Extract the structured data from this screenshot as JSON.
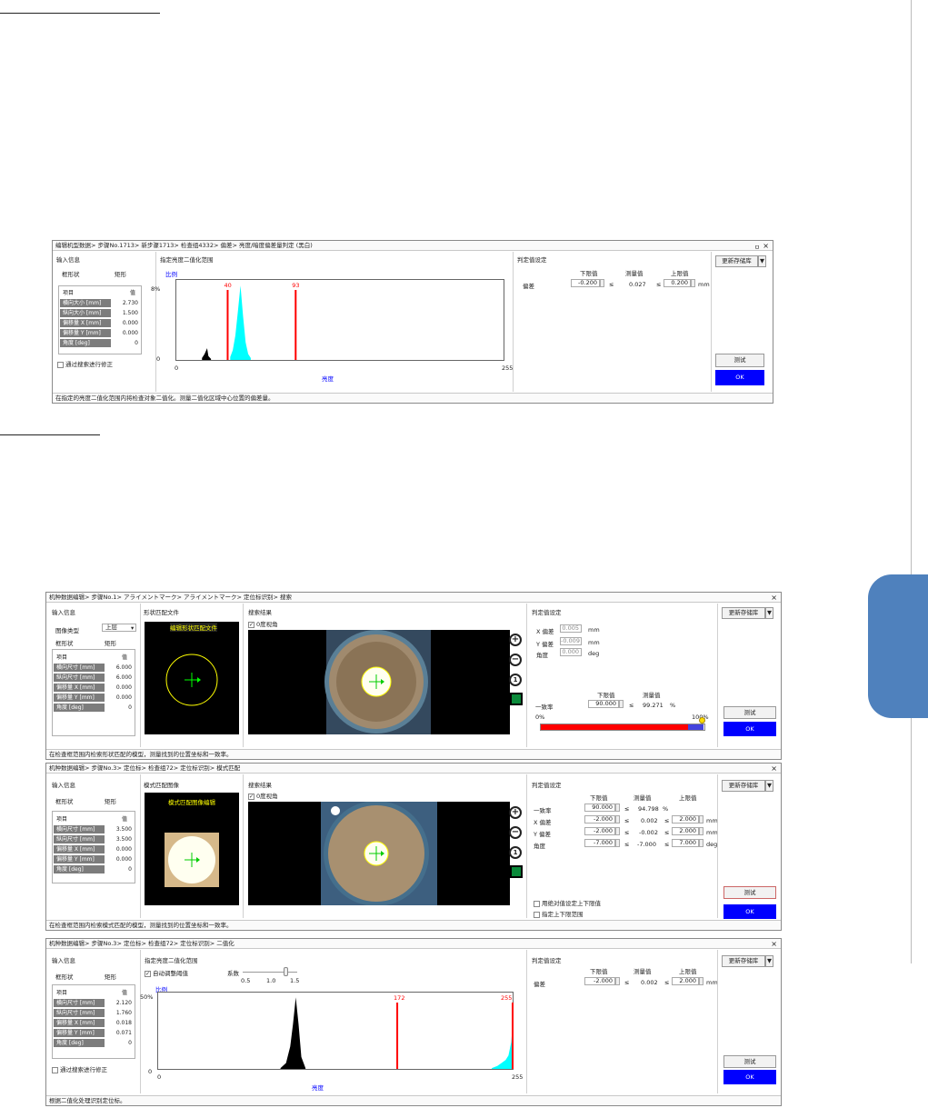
{
  "page": {
    "side_tab_color": "#4f81bd"
  },
  "panel1": {
    "title": "编辑机型数据> 步骤No.1713> 新步骤1713> 检查组4332> 偏差> 亮度/暗度偏差量判定 (黑白)",
    "close": "×",
    "pin": "ㅁ",
    "input_info": "输入信息",
    "shape_label": "框形状",
    "shape_value": "矩形",
    "table_head": {
      "item": "项目",
      "value": "值"
    },
    "params": [
      {
        "k": "横向大小 [mm]",
        "v": "2.730"
      },
      {
        "k": "纵向大小 [mm]",
        "v": "1.500"
      },
      {
        "k": "偏移量 X [mm]",
        "v": "0.000"
      },
      {
        "k": "偏移量 Y [mm]",
        "v": "0.000"
      },
      {
        "k": "角度 [deg]",
        "v": "0"
      }
    ],
    "correct_checkbox": "通过搜索进行修正",
    "histogram_title": "指定亮度二值化范围",
    "ratio": "比例",
    "y_max": "8%",
    "y_min": "0",
    "x_min": "0",
    "x_max": "255",
    "x_label": "亮度",
    "judge_title": "判定值设定",
    "lower_head": "下限值",
    "measured_head": "测量值",
    "upper_head": "上限值",
    "row_label": "偏差",
    "lower": "-0.200",
    "measured": "0.027",
    "upper": "0.200",
    "le1": "≤",
    "le2": "≤",
    "unit": "mm",
    "update_button": "更新存储库",
    "test_button": "测试",
    "ok_button": "OK",
    "status": "在指定的亮度二值化范围内将检查对象二值化。测量二值化区域中心位置的偏差量。"
  },
  "panel2": {
    "title": "机种数据编辑> 步骤No.1> アライメントマーク> アライメントマーク> 定位标识别> 搜索",
    "close": "×",
    "input_info": "输入信息",
    "image_type_label": "图像类型",
    "image_type_value": "上层",
    "shape_label": "框形状",
    "shape_value": "矩形",
    "table_head": {
      "item": "项目",
      "value": "值"
    },
    "params": [
      {
        "k": "横向尺寸 [mm]",
        "v": "6.000"
      },
      {
        "k": "纵向尺寸 [mm]",
        "v": "6.000"
      },
      {
        "k": "偏移量 X [mm]",
        "v": "0.000"
      },
      {
        "k": "偏移量 Y [mm]",
        "v": "0.000"
      },
      {
        "k": "角度 [deg]",
        "v": "0"
      }
    ],
    "match_file_title": "形状匹配文件",
    "match_file_button": "编辑形状匹配文件",
    "search_result_title": "搜索结果",
    "zero_view": "0度视角",
    "judge_title": "判定值设定",
    "x_dev_label": "X 偏差",
    "x_dev": "0.005",
    "y_dev_label": "Y 偏差",
    "y_dev": "-0.009",
    "angle_label": "角度",
    "angle": "0.000",
    "unit_mm1": "mm",
    "unit_mm2": "mm",
    "unit_deg": "deg",
    "lower_head": "下限值",
    "measured_head": "测量值",
    "match_label": "一致率",
    "match_lower": "90.000",
    "match_measured": "99.271",
    "le": "≤",
    "pct": "%",
    "bar_min": "0%",
    "bar_max": "100%",
    "update_button": "更新存储库",
    "test_button": "测试",
    "ok_button": "OK",
    "status": "在检查框范围内检索形状匹配的模型，测量找到的位置坐标和一致率。"
  },
  "panel3": {
    "title": "机种数据编辑> 步骤No.3> 定位标> 检查组72> 定位标识别> 模式匹配",
    "close": "×",
    "input_info": "输入信息",
    "shape_label": "框形状",
    "shape_value": "矩形",
    "table_head": {
      "item": "项目",
      "value": "值"
    },
    "params": [
      {
        "k": "横向尺寸 [mm]",
        "v": "3.500"
      },
      {
        "k": "纵向尺寸 [mm]",
        "v": "3.500"
      },
      {
        "k": "偏移量 X [mm]",
        "v": "0.000"
      },
      {
        "k": "偏移量 Y [mm]",
        "v": "0.000"
      },
      {
        "k": "角度 [deg]",
        "v": "0"
      }
    ],
    "pattern_title": "模式匹配图像",
    "pattern_button": "模式匹配图像编辑",
    "search_result_title": "搜索结果",
    "zero_view": "0度视角",
    "judge_title": "判定值设定",
    "lower_head": "下限值",
    "measured_head": "测量值",
    "upper_head": "上限值",
    "rows": [
      {
        "label": "一致率",
        "lower": "90.000",
        "measured": "94.798",
        "upper": "",
        "unit": "%"
      },
      {
        "label": "X 偏差",
        "lower": "-2.000",
        "measured": "0.002",
        "upper": "2.000",
        "unit": "mm"
      },
      {
        "label": "Y 偏差",
        "lower": "-2.000",
        "measured": "-0.002",
        "upper": "2.000",
        "unit": "mm"
      },
      {
        "label": "角度",
        "lower": "-7.000",
        "measured": "-7.000",
        "upper": "7.000",
        "unit": "deg"
      }
    ],
    "le": "≤",
    "abs_checkbox": "用绝对值设定上下限值",
    "no_limit_checkbox": "指定上下限范围",
    "update_button": "更新存储库",
    "test_button": "测试",
    "ok_button": "OK",
    "status": "在检查框范围内检索模式匹配的模型，测量找到的位置坐标和一致率。"
  },
  "panel4": {
    "title": "机种数据编辑> 步骤No.3> 定位标> 检查组72> 定位标识别> 二值化",
    "close": "×",
    "input_info": "输入信息",
    "shape_label": "框形状",
    "shape_value": "矩形",
    "table_head": {
      "item": "项目",
      "value": "值"
    },
    "params": [
      {
        "k": "横向尺寸 [mm]",
        "v": "2.120"
      },
      {
        "k": "纵向尺寸 [mm]",
        "v": "1.760"
      },
      {
        "k": "偏移量 X [mm]",
        "v": "0.018"
      },
      {
        "k": "偏移量 Y [mm]",
        "v": "0.071"
      },
      {
        "k": "角度 [deg]",
        "v": "0"
      }
    ],
    "correct_checkbox": "通过搜索进行修正",
    "histogram_title": "指定亮度二值化范围",
    "auto_threshold": "自动调整阈值",
    "coef_label": "系数",
    "coef_ticks": [
      "0.5",
      "1.0",
      "1.5"
    ],
    "ratio": "比例",
    "y_max": "50%",
    "y_min": "0",
    "x_min": "0",
    "x_max": "255",
    "x_label": "亮度",
    "judge_title": "判定值设定",
    "lower_head": "下限值",
    "measured_head": "测量值",
    "upper_head": "上限值",
    "row_label": "偏差",
    "lower": "-2.000",
    "measured": "0.002",
    "upper": "2.000",
    "le1": "≤",
    "le2": "≤",
    "unit": "mm",
    "update_button": "更新存储库",
    "test_button": "测试",
    "ok_button": "OK",
    "status": "根据二值化处理识别定位标。"
  },
  "chart_data": [
    {
      "type": "area",
      "title": "指定亮度二值化范围",
      "xlabel": "亮度",
      "ylabel": "比例",
      "xlim": [
        0,
        255
      ],
      "ylim": [
        0,
        8
      ],
      "series": [
        {
          "values_x": [
            20,
            22,
            24,
            25,
            27
          ],
          "values_y": [
            0.2,
            0.6,
            1.2,
            0.4,
            0.1
          ],
          "color": "#000000"
        },
        {
          "values_x": [
            42,
            44,
            46,
            48,
            50,
            52,
            54,
            56,
            58
          ],
          "values_y": [
            0.3,
            1.0,
            2.5,
            5.0,
            7.6,
            4.5,
            1.8,
            0.6,
            0.2
          ],
          "color": "#00ffff"
        }
      ],
      "thresholds": [
        40,
        93
      ],
      "threshold_color": "#ff0000"
    },
    {
      "type": "area",
      "title": "指定亮度二值化范围",
      "xlabel": "亮度",
      "ylabel": "比例",
      "xlim": [
        0,
        255
      ],
      "ylim": [
        0,
        50
      ],
      "series": [
        {
          "values_x": [
            88,
            92,
            95,
            97,
            99,
            101,
            103,
            106
          ],
          "values_y": [
            0.5,
            4,
            15,
            30,
            48,
            30,
            8,
            0.5
          ],
          "color": "#000000"
        },
        {
          "values_x": [
            240,
            244,
            247,
            250,
            252,
            254,
            255
          ],
          "values_y": [
            0.5,
            2,
            4,
            6,
            9,
            18,
            30
          ],
          "color": "#00ffff"
        }
      ],
      "thresholds": [
        172,
        255
      ],
      "threshold_color": "#ff0000"
    }
  ]
}
